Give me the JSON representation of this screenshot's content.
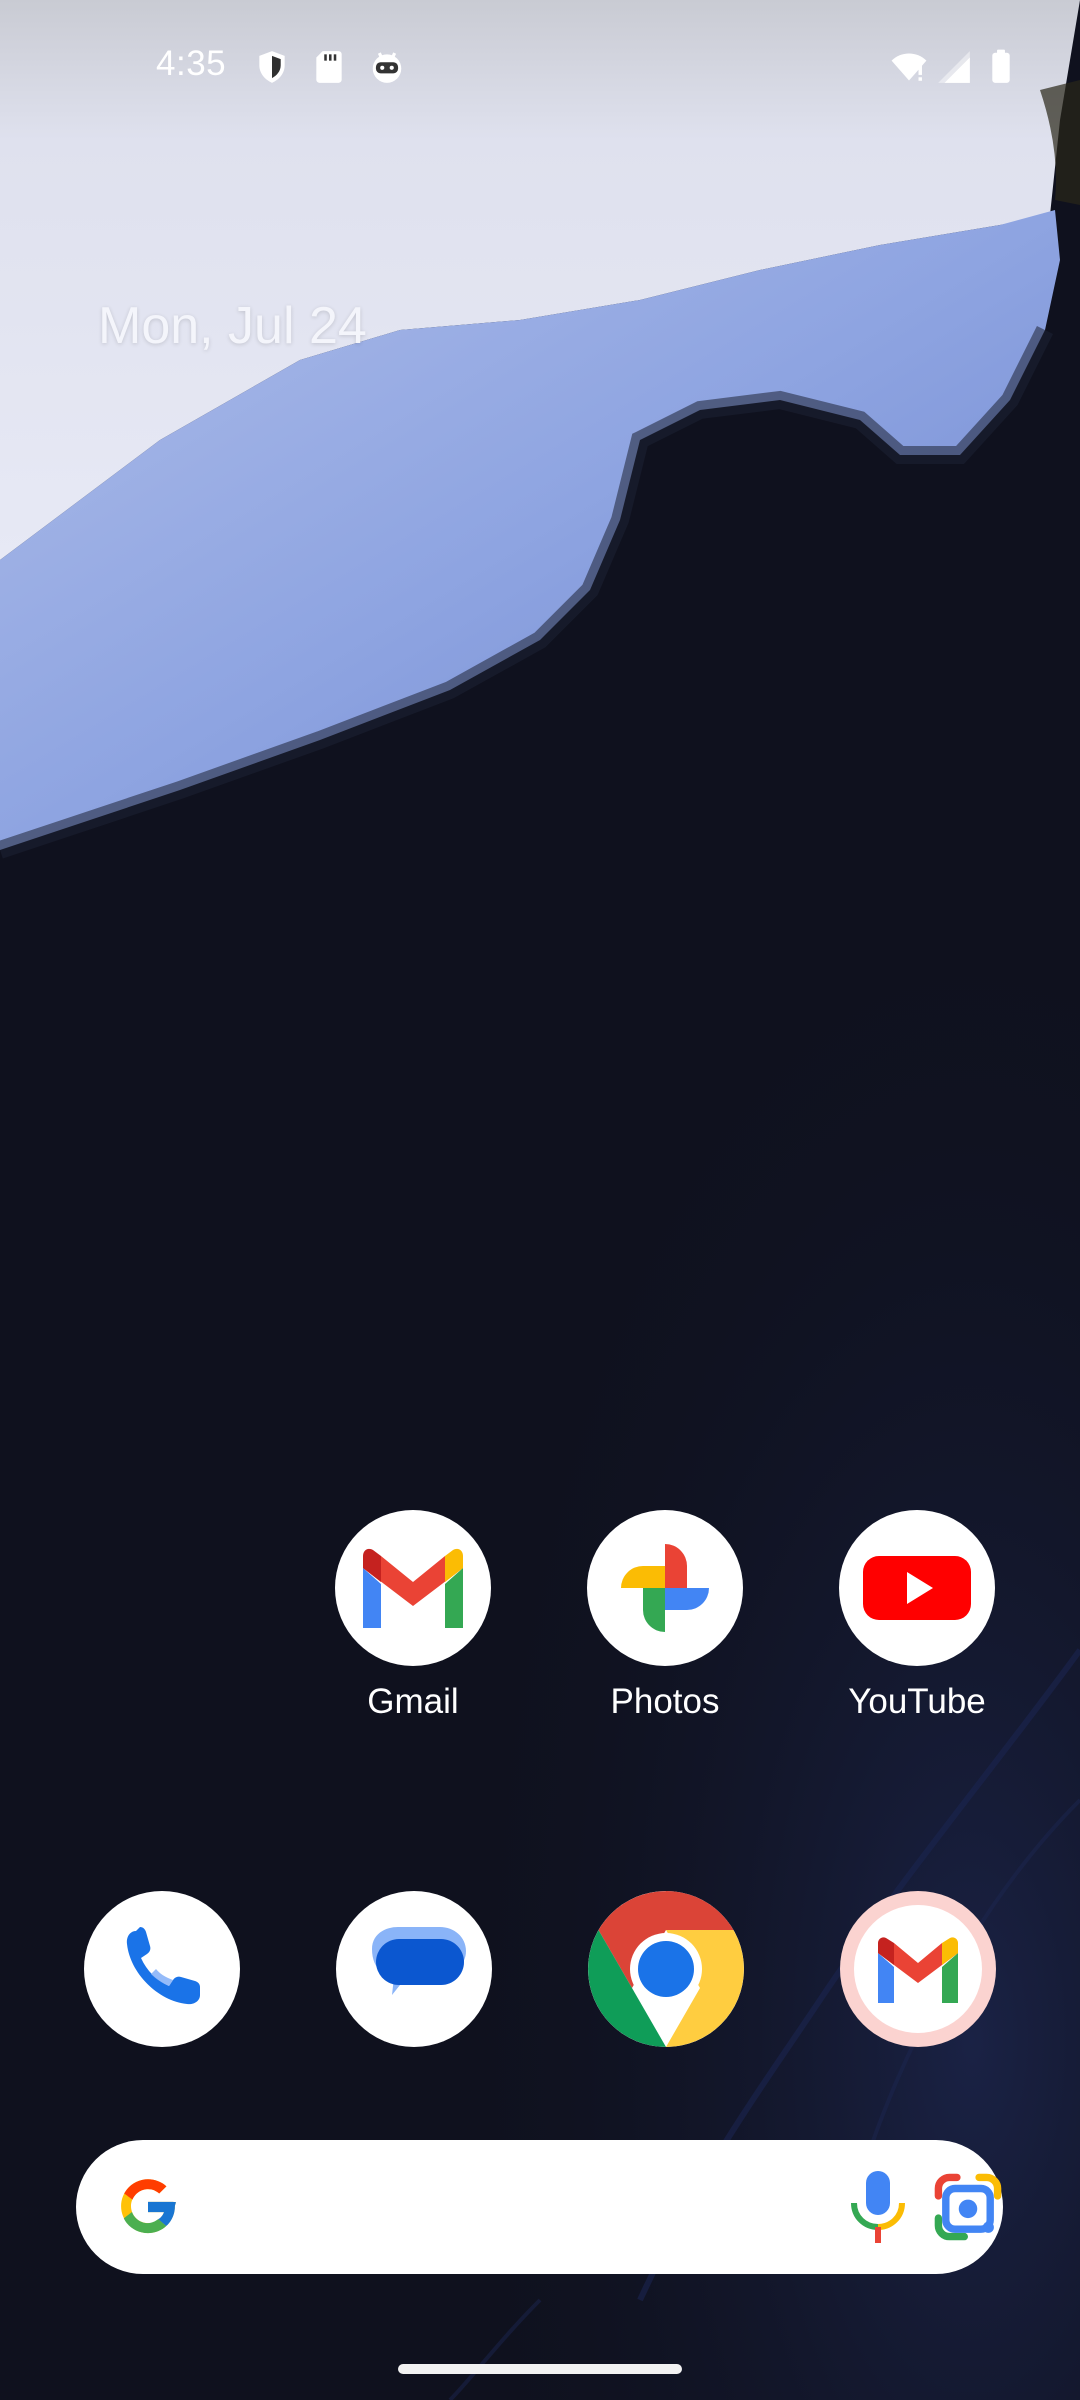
{
  "status_bar": {
    "time": "4:35",
    "left_icons": [
      "shield-icon",
      "sd-card-icon",
      "android-face-icon"
    ],
    "right_icons": [
      "wifi-alert-icon",
      "cell-signal-icon",
      "battery-icon"
    ]
  },
  "home": {
    "date": "Mon, Jul 24",
    "apps": [
      {
        "label": "Gmail",
        "icon": "gmail-icon"
      },
      {
        "label": "Photos",
        "icon": "photos-icon"
      },
      {
        "label": "YouTube",
        "icon": "youtube-icon"
      }
    ],
    "dock": [
      {
        "icon": "phone-icon"
      },
      {
        "icon": "messages-icon"
      },
      {
        "icon": "chrome-icon"
      },
      {
        "icon": "gmail-icon"
      }
    ]
  },
  "search": {
    "placeholder": "",
    "icons": [
      "google-g-icon",
      "microphone-icon",
      "google-lens-icon"
    ]
  },
  "colors": {
    "background": "#0f111e",
    "wallpaper_blue": "#8fa4e0",
    "wallpaper_light": "#dfe2f0",
    "text": "#ffffff"
  }
}
